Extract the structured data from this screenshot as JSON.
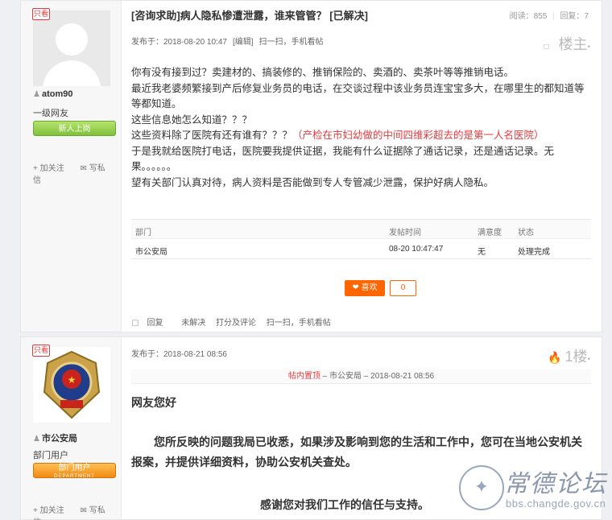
{
  "post1": {
    "author": {
      "badge": "只看",
      "name": "atom90",
      "level": "一级网友",
      "medal": "新人上岗",
      "follow_label": "加关注",
      "message_label": "写私信"
    },
    "title": "[咨询求助]病人隐私惨遭泄露，谁来管管？ [已解决]",
    "views_label": "阅读：",
    "views": "855",
    "replies_label": "回复：",
    "replies": "7",
    "meta": {
      "posted": "发布于：2018-08-20 10:47",
      "edit": "[编辑]",
      "scan": "扫一扫，手机看帖"
    },
    "floor": "楼主",
    "content": {
      "p1": "你有没有接到过？卖建材的、搞装修的、推销保险的、卖酒的、卖茶叶等等推销电话。",
      "p2": "最近我老婆频繁接到产后修复业务员的电话，在交谈过程中该业务员连宝宝多大，在哪里生的都知道等等都知道。",
      "p3": "这些信息她怎么知道？？？",
      "p4a": "这些资料除了医院有还有谁有？？？",
      "p4b": "（产检在市妇幼做的中间四维彩超去的是第一人名医院）",
      "p5": "于是我就给医院打电话，医院要我提供证据，我能有什么证据除了通话记录，还是通话记录。无果。。。。。。",
      "p6": "望有关部门认真对待，病人资料是否能做到专人专管减少泄露，保护好病人隐私。"
    },
    "table": {
      "headers": [
        "部门",
        "发帖时间",
        "满意度",
        "状态"
      ],
      "row": [
        "市公安局",
        "08-20 10:47:47",
        "无",
        "处理完成"
      ]
    },
    "like_label": "喜欢",
    "like_count": "0",
    "actions": [
      "回复",
      "未解决",
      "打分及评论",
      "扫一扫，手机看帖"
    ]
  },
  "post2": {
    "author": {
      "badge": "只看",
      "name": "市公安局",
      "level": "部门用户",
      "medal": "部门用户",
      "medal_sub": "DEPARTMENT",
      "follow_label": "加关注",
      "message_label": "写私信"
    },
    "meta": {
      "posted": "发布于：2018-08-21 08:56"
    },
    "floor": "1楼",
    "quote": {
      "tag": "帖内置顶",
      "sep1": " – ",
      "who": "市公安局",
      "sep2": " – ",
      "time": "2018-08-21 08:56"
    },
    "greeting": "网友您好",
    "body": "您所反映的问题我局已收悉，如果涉及影响到您的生活和工作中，您可在当地公安机关报案，并提供详细资料，协助公安机关查处。",
    "thanks": "感谢您对我们工作的信任与支持。"
  },
  "watermark": {
    "title": "常德论坛",
    "url": "bbs.changde.gov.cn",
    "seal_text": "bbs.changde.gov.cn"
  },
  "colors": {
    "accent": "#e4393c",
    "like": "#ff6600",
    "medal_green": "#7fc13b",
    "medal_orange": "#f08a12"
  }
}
